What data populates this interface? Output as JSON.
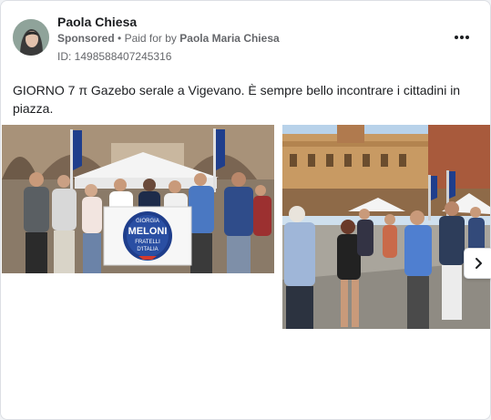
{
  "ad": {
    "advertiser_name": "Paola Chiesa",
    "sponsored_label": "Sponsored",
    "separator": "•",
    "paid_for_text": "Paid for by",
    "payer_name": "Paola Maria Chiesa",
    "ad_id": "ID: 1498588407245316",
    "body_text": "GIORNO 7 π Gazebo serale a Vigevano. È sempre bello incontrare i cittadini in piazza."
  },
  "carousel": {
    "photo1": {
      "banner_line1": "GIORGIA",
      "banner_line2": "MELONI",
      "banner_line3": "FRATELLI",
      "banner_line4": "D'ITALIA"
    }
  },
  "colors": {
    "text_primary": "#1c1e21",
    "text_secondary": "#65676b",
    "brand_blue": "#1f3e8c"
  },
  "icons": {
    "more": "more-horizontal-icon",
    "next": "chevron-right-icon"
  }
}
